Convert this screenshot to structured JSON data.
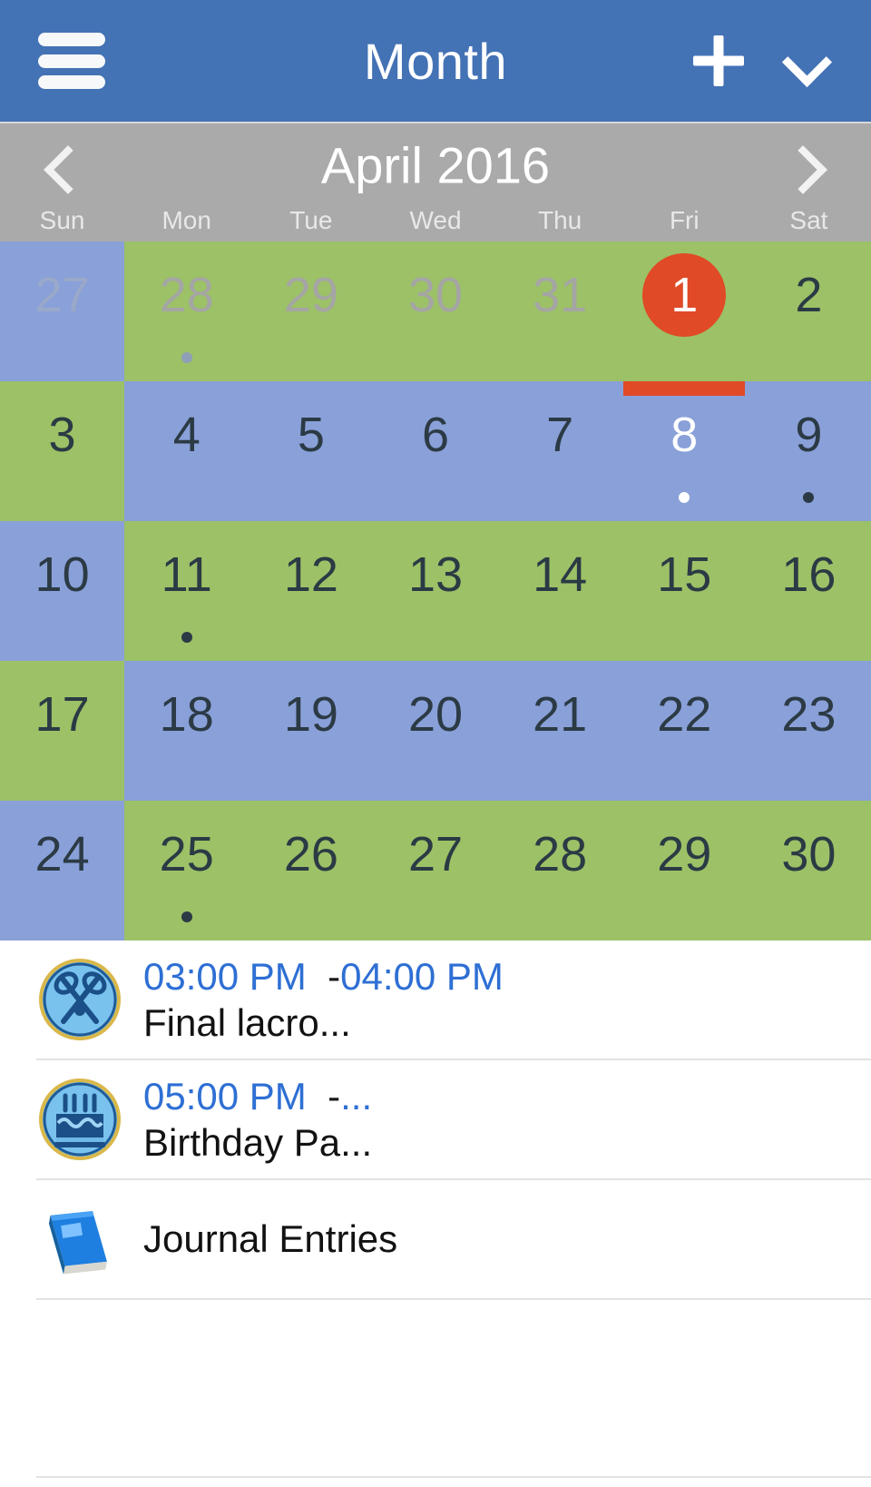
{
  "appbar": {
    "menu_icon": "hamburger-icon",
    "title": "Month",
    "add_icon": "plus-icon",
    "expand_icon": "chevron-down-icon"
  },
  "monthbar": {
    "prev_icon": "chevron-left-icon",
    "next_icon": "chevron-right-icon",
    "month_label": "April 2016",
    "weekdays": [
      "Sun",
      "Mon",
      "Tue",
      "Wed",
      "Thu",
      "Fri",
      "Sat"
    ]
  },
  "colors": {
    "appbar_blue": "#4372b5",
    "monthbar_gray": "#aaaaaa",
    "cell_green": "#9cc167",
    "cell_blue": "#89a0d8",
    "accent_red": "#e04a26",
    "time_blue": "#2e6fd4"
  },
  "calendar": {
    "rows": [
      [
        {
          "day": "27",
          "tone": "blue",
          "muted": true,
          "dot": "none"
        },
        {
          "day": "28",
          "tone": "green",
          "muted": true,
          "dot": "faint"
        },
        {
          "day": "29",
          "tone": "green",
          "muted": true,
          "dot": "none"
        },
        {
          "day": "30",
          "tone": "green",
          "muted": true,
          "dot": "none"
        },
        {
          "day": "31",
          "tone": "green",
          "muted": true,
          "dot": "none"
        },
        {
          "day": "1",
          "tone": "green",
          "muted": false,
          "dot": "none",
          "selected": true
        },
        {
          "day": "2",
          "tone": "green",
          "muted": false,
          "dot": "none"
        }
      ],
      [
        {
          "day": "3",
          "tone": "green",
          "muted": false,
          "dot": "none"
        },
        {
          "day": "4",
          "tone": "blue",
          "muted": false,
          "dot": "none"
        },
        {
          "day": "5",
          "tone": "blue",
          "muted": false,
          "dot": "none"
        },
        {
          "day": "6",
          "tone": "blue",
          "muted": false,
          "dot": "none"
        },
        {
          "day": "7",
          "tone": "blue",
          "muted": false,
          "dot": "none"
        },
        {
          "day": "8",
          "tone": "blue",
          "muted": false,
          "dot": "light",
          "today": true
        },
        {
          "day": "9",
          "tone": "blue",
          "muted": false,
          "dot": "dark"
        }
      ],
      [
        {
          "day": "10",
          "tone": "blue",
          "muted": false,
          "dot": "none"
        },
        {
          "day": "11",
          "tone": "green",
          "muted": false,
          "dot": "dark"
        },
        {
          "day": "12",
          "tone": "green",
          "muted": false,
          "dot": "none"
        },
        {
          "day": "13",
          "tone": "green",
          "muted": false,
          "dot": "none"
        },
        {
          "day": "14",
          "tone": "green",
          "muted": false,
          "dot": "none"
        },
        {
          "day": "15",
          "tone": "green",
          "muted": false,
          "dot": "none"
        },
        {
          "day": "16",
          "tone": "green",
          "muted": false,
          "dot": "none"
        }
      ],
      [
        {
          "day": "17",
          "tone": "green",
          "muted": false,
          "dot": "none"
        },
        {
          "day": "18",
          "tone": "blue",
          "muted": false,
          "dot": "none"
        },
        {
          "day": "19",
          "tone": "blue",
          "muted": false,
          "dot": "none"
        },
        {
          "day": "20",
          "tone": "blue",
          "muted": false,
          "dot": "none"
        },
        {
          "day": "21",
          "tone": "blue",
          "muted": false,
          "dot": "none"
        },
        {
          "day": "22",
          "tone": "blue",
          "muted": false,
          "dot": "none"
        },
        {
          "day": "23",
          "tone": "blue",
          "muted": false,
          "dot": "none"
        }
      ],
      [
        {
          "day": "24",
          "tone": "blue",
          "muted": false,
          "dot": "none"
        },
        {
          "day": "25",
          "tone": "green",
          "muted": false,
          "dot": "dark"
        },
        {
          "day": "26",
          "tone": "green",
          "muted": false,
          "dot": "none"
        },
        {
          "day": "27",
          "tone": "green",
          "muted": false,
          "dot": "none"
        },
        {
          "day": "28",
          "tone": "green",
          "muted": false,
          "dot": "none"
        },
        {
          "day": "29",
          "tone": "green",
          "muted": false,
          "dot": "none"
        },
        {
          "day": "30",
          "tone": "green",
          "muted": false,
          "dot": "none"
        }
      ]
    ]
  },
  "events": [
    {
      "icon": "lacrosse-icon",
      "start_time": "03:00 PM",
      "dash": "-",
      "end_time": "04:00 PM",
      "title": "Final lacro..."
    },
    {
      "icon": "birthday-cake-icon",
      "start_time": "05:00 PM",
      "dash": "-",
      "end_time": "...",
      "title": "Birthday Pa..."
    }
  ],
  "journal": {
    "icon": "book-icon",
    "label": "Journal Entries"
  }
}
